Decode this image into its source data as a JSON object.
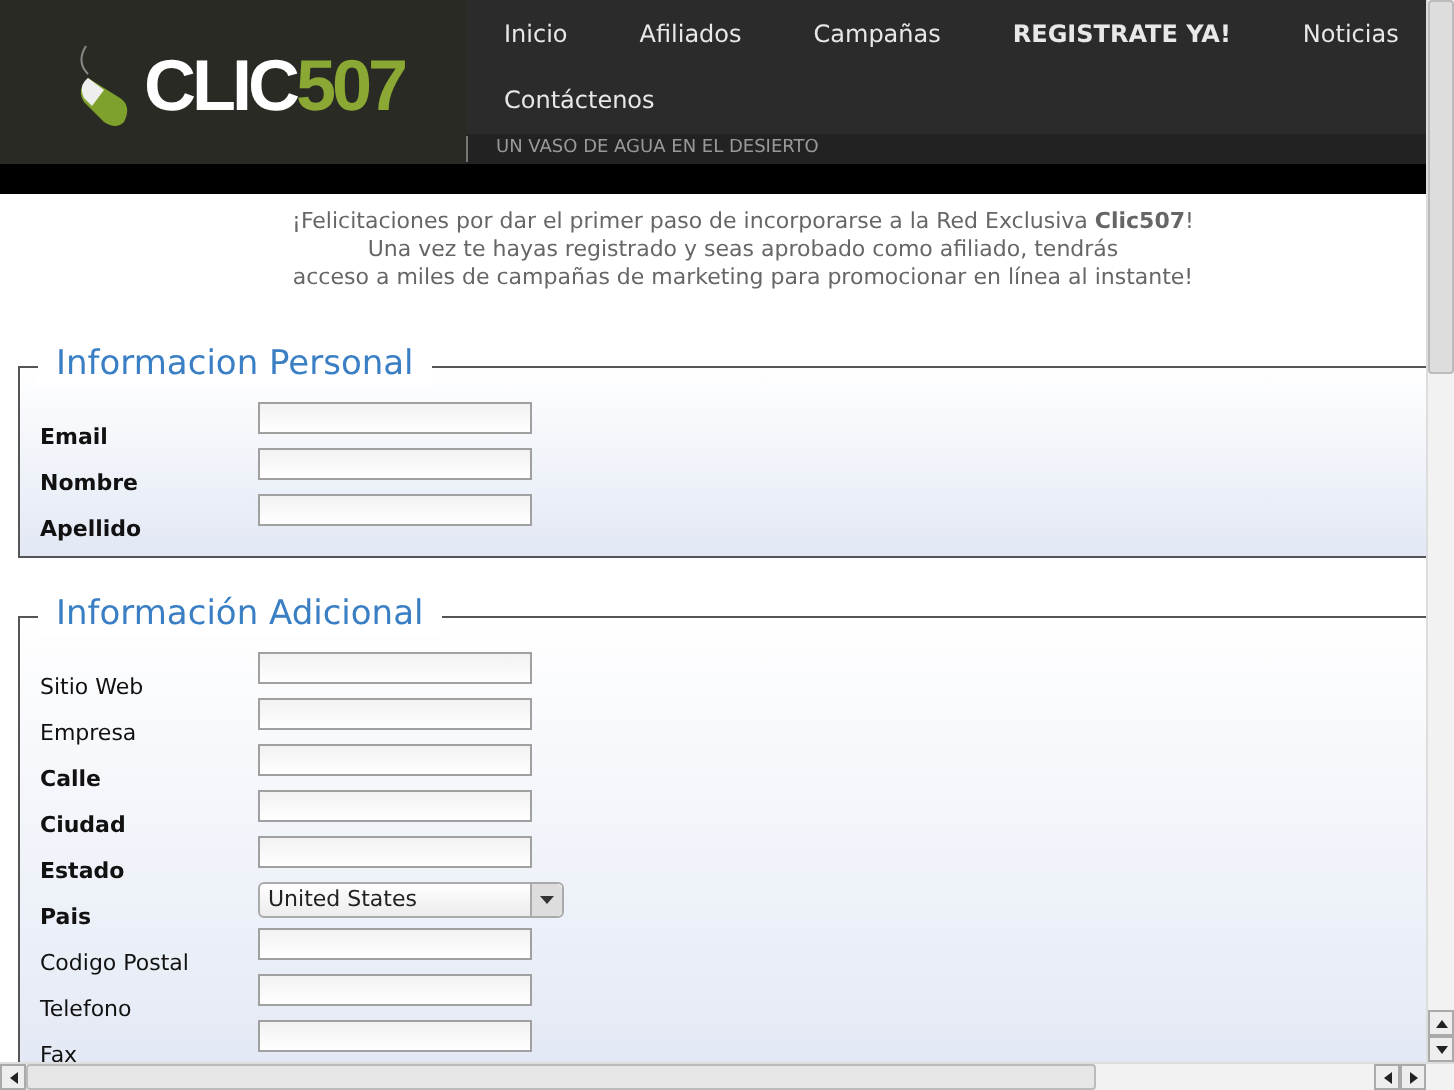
{
  "logo": {
    "text": "CLIC",
    "number": "507"
  },
  "nav": [
    {
      "label": "Inicio",
      "emphasis": false
    },
    {
      "label": "Afiliados",
      "emphasis": false
    },
    {
      "label": "Campañas",
      "emphasis": false
    },
    {
      "label": "REGISTRATE YA!",
      "emphasis": true
    },
    {
      "label": "Noticias",
      "emphasis": false
    },
    {
      "label": "Contáctenos",
      "emphasis": false
    }
  ],
  "tagline": "UN VASO DE AGUA EN EL DESIERTO",
  "intro": [
    "¡Felicitaciones por dar el primer paso de incorporarse a la Red Exclusiva **Clic507**!",
    "Una vez te hayas registrado y seas aprobado como afiliado, tendrás",
    "acceso a miles de campañas de marketing para promocionar en línea al instante!"
  ],
  "sections": [
    {
      "title": "Informacion Personal",
      "fields": [
        {
          "label": "Email",
          "required": true,
          "kind": "text"
        },
        {
          "label": "Nombre",
          "required": true,
          "kind": "text"
        },
        {
          "label": "Apellido",
          "required": true,
          "kind": "text"
        }
      ]
    },
    {
      "title": "Información Adicional",
      "fields": [
        {
          "label": "Sitio Web",
          "required": false,
          "kind": "text"
        },
        {
          "label": "Empresa",
          "required": false,
          "kind": "text"
        },
        {
          "label": "Calle",
          "required": true,
          "kind": "text"
        },
        {
          "label": "Ciudad",
          "required": true,
          "kind": "text"
        },
        {
          "label": "Estado",
          "required": true,
          "kind": "text"
        },
        {
          "label": "Pais",
          "required": true,
          "kind": "select",
          "value": "United States"
        },
        {
          "label": "Codigo Postal",
          "required": false,
          "kind": "text"
        },
        {
          "label": "Telefono",
          "required": false,
          "kind": "text"
        },
        {
          "label": "Fax",
          "required": false,
          "kind": "text"
        }
      ]
    }
  ]
}
